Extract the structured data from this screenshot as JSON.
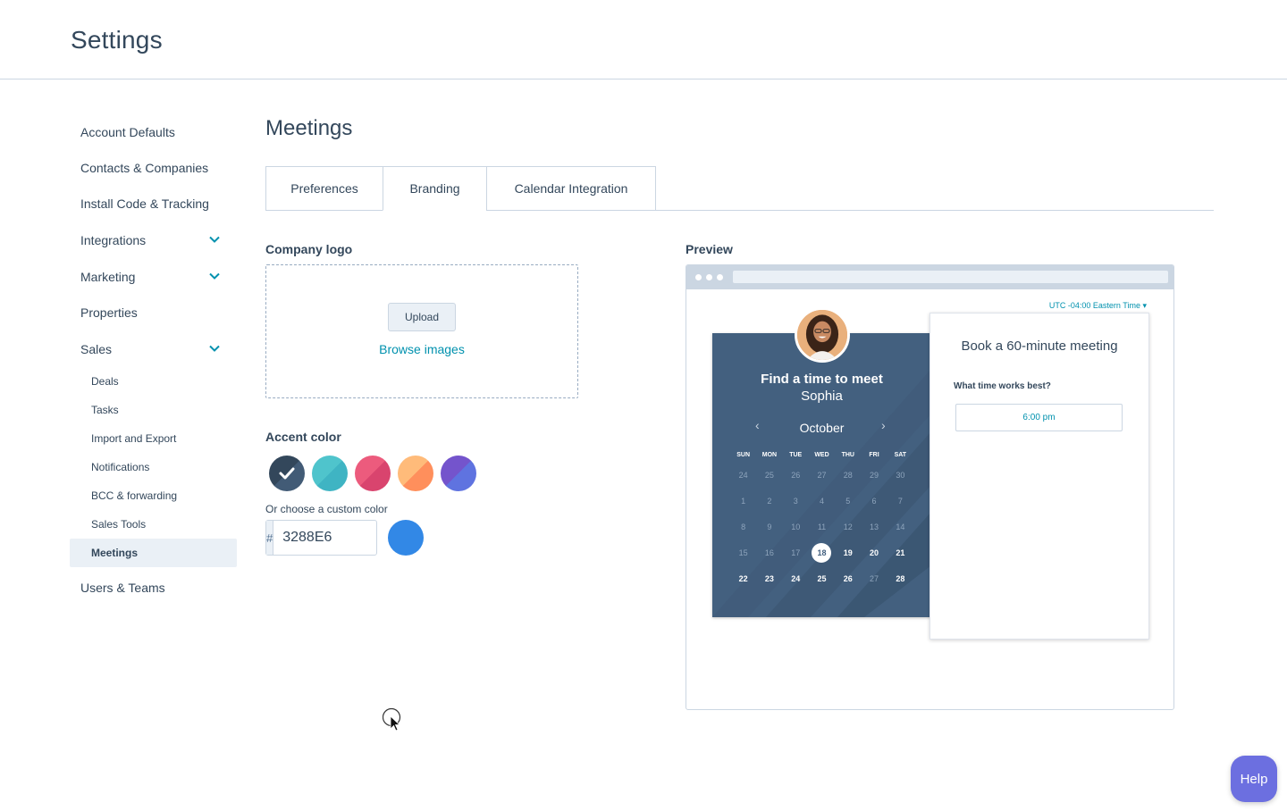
{
  "header": {
    "title": "Settings"
  },
  "sidebar": {
    "items": [
      {
        "label": "Account Defaults"
      },
      {
        "label": "Contacts & Companies"
      },
      {
        "label": "Install Code & Tracking"
      },
      {
        "label": "Integrations",
        "icon": "chevron-down-icon"
      },
      {
        "label": "Marketing",
        "icon": "chevron-down-icon"
      },
      {
        "label": "Properties"
      },
      {
        "label": "Sales",
        "icon": "chevron-down-icon"
      }
    ],
    "sales_sub": [
      {
        "label": "Deals"
      },
      {
        "label": "Tasks"
      },
      {
        "label": "Import and Export"
      },
      {
        "label": "Notifications"
      },
      {
        "label": "BCC & forwarding"
      },
      {
        "label": "Sales Tools"
      },
      {
        "label": "Meetings",
        "active": true
      }
    ],
    "last": {
      "label": "Users & Teams"
    }
  },
  "main": {
    "title": "Meetings",
    "tabs": [
      {
        "label": "Preferences"
      },
      {
        "label": "Branding",
        "active": true
      },
      {
        "label": "Calendar Integration"
      }
    ],
    "company_logo": {
      "label": "Company logo",
      "upload_label": "Upload",
      "browse_label": "Browse images"
    },
    "accent": {
      "label": "Accent color",
      "swatches": [
        {
          "color": "#33475b",
          "color2": "#425b76",
          "selected": true,
          "icon": "checkmark-icon"
        },
        {
          "color": "#00bda5",
          "color2": "#51d3d9"
        },
        {
          "color": "#e0416b",
          "color2": "#f2547d"
        },
        {
          "color": "#ff8f59",
          "color2": "#ffbc7d"
        },
        {
          "color": "#5c62d6",
          "color2": "#6a78d1"
        }
      ],
      "custom_label": "Or choose a custom color",
      "hex_prefix": "#",
      "hex_value": "3288E6",
      "custom_color": "#3288E6"
    }
  },
  "preview": {
    "label": "Preview",
    "timezone": "UTC -04:00 Eastern Time",
    "calendar": {
      "title": "Find a time to meet",
      "name": "Sophia",
      "month": "October",
      "weekdays": [
        "SUN",
        "MON",
        "TUE",
        "WED",
        "THU",
        "FRI",
        "SAT"
      ],
      "weeks": [
        [
          "24",
          "25",
          "26",
          "27",
          "28",
          "29",
          "30"
        ],
        [
          "1",
          "2",
          "3",
          "4",
          "5",
          "6",
          "7"
        ],
        [
          "8",
          "9",
          "10",
          "11",
          "12",
          "13",
          "14"
        ],
        [
          "15",
          "16",
          "17",
          "18",
          "19",
          "20",
          "21"
        ],
        [
          "22",
          "23",
          "24",
          "25",
          "26",
          "27",
          "28"
        ]
      ],
      "today": "18"
    },
    "booking": {
      "title": "Book a 60-minute meeting",
      "question": "What time works best?",
      "slot": "6:00 pm"
    }
  },
  "help": {
    "label": "Help"
  }
}
